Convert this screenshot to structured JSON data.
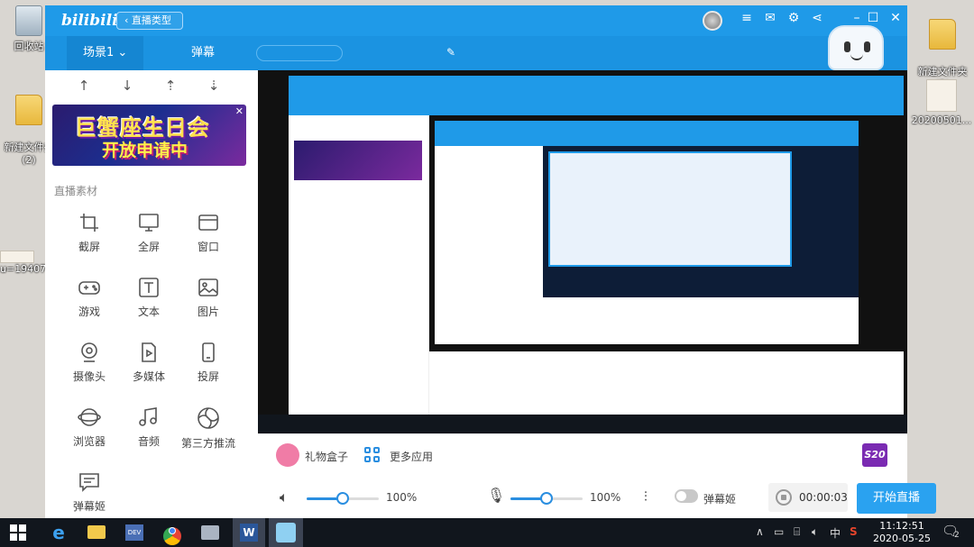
{
  "desktop": {
    "icons": [
      {
        "label": "回收站"
      },
      {
        "label": "新建文件夹\n(2)"
      },
      {
        "label": "新建文件夹\n(3)"
      },
      {
        "label": "20200501..."
      }
    ],
    "partial_text": [
      "u=194076"
    ]
  },
  "app": {
    "logo": "bilibili",
    "back_label": "直播类型",
    "tabs": [
      {
        "label": "场景1"
      },
      {
        "label": "弹幕"
      }
    ],
    "toolbar_arrows": [
      "↑",
      "↓",
      "⇡",
      "⇣"
    ],
    "banner": {
      "line1": "巨蟹座生日会",
      "line2": "开放申请中"
    },
    "section_title": "直播素材",
    "tools": [
      {
        "label": "截屏",
        "icon": "crop-icon"
      },
      {
        "label": "全屏",
        "icon": "monitor-icon"
      },
      {
        "label": "窗口",
        "icon": "window-icon"
      },
      {
        "label": "游戏",
        "icon": "gamepad-icon"
      },
      {
        "label": "文本",
        "icon": "text-icon"
      },
      {
        "label": "图片",
        "icon": "image-icon"
      },
      {
        "label": "摄像头",
        "icon": "camera-icon"
      },
      {
        "label": "多媒体",
        "icon": "media-icon"
      },
      {
        "label": "投屏",
        "icon": "phone-icon"
      },
      {
        "label": "浏览器",
        "icon": "globe-icon"
      },
      {
        "label": "音频",
        "icon": "music-icon"
      },
      {
        "label": "第三方推流",
        "icon": "stream-icon"
      },
      {
        "label": "弹幕姬",
        "icon": "chat-icon"
      }
    ],
    "bottom": {
      "gift_label": "礼物盒子",
      "apps_label": "更多应用",
      "badge": "S20",
      "speaker_volume": 0.5,
      "speaker_percent": "100%",
      "mic_volume": 0.5,
      "mic_percent": "100%",
      "danmaku_toggle_label": "弹幕姬",
      "timer": "00:00:03",
      "start_label": "开始直播"
    }
  },
  "taskbar": {
    "time": "11:12:51",
    "date": "2020-05-25",
    "ime": "中",
    "notification_count": "2"
  },
  "colors": {
    "accent": "#1f9ae8",
    "button": "#2aa2f0",
    "badge": "#7a2ab2"
  }
}
